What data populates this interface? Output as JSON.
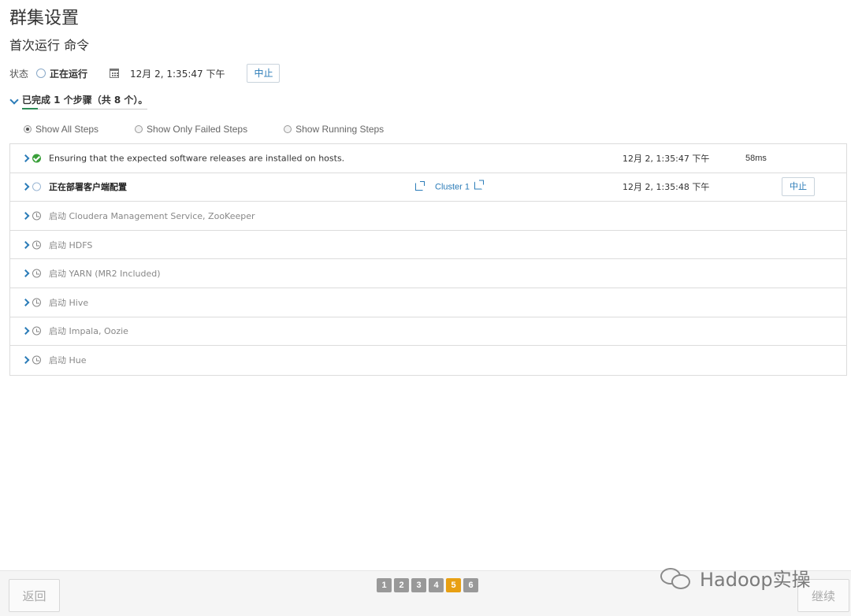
{
  "page": {
    "title": "群集设置",
    "subtitle": "首次运行 命令"
  },
  "status": {
    "label": "状态",
    "value": "正在运行",
    "timestamp": "12月 2, 1:35:47 下午",
    "abort_label": "中止"
  },
  "progress": {
    "summary": "已完成 1 个步骤（共 8 个）。",
    "completed": 1,
    "total": 8
  },
  "filters": [
    {
      "label": "Show All Steps",
      "checked": true
    },
    {
      "label": "Show Only Failed Steps",
      "checked": false
    },
    {
      "label": "Show Running Steps",
      "checked": false
    }
  ],
  "steps": [
    {
      "name": "Ensuring that the expected software releases are installed on hosts.",
      "state": "done",
      "time": "12月 2, 1:35:47 下午",
      "duration": "58ms"
    },
    {
      "name": "正在部署客户端配置",
      "state": "running",
      "time": "12月 2, 1:35:48 下午",
      "link": "Cluster 1",
      "abort_label": "中止"
    },
    {
      "name": "启动 Cloudera Management Service, ZooKeeper",
      "state": "pending"
    },
    {
      "name": "启动 HDFS",
      "state": "pending"
    },
    {
      "name": "启动 YARN (MR2 Included)",
      "state": "pending"
    },
    {
      "name": "启动 Hive",
      "state": "pending"
    },
    {
      "name": "启动 Impala, Oozie",
      "state": "pending"
    },
    {
      "name": "启动 Hue",
      "state": "pending"
    }
  ],
  "footer": {
    "back_label": "返回",
    "continue_label": "继续",
    "pages": [
      "1",
      "2",
      "3",
      "4",
      "5",
      "6"
    ],
    "active_page": "5"
  },
  "watermark": {
    "text": "Hadoop实操"
  },
  "colors": {
    "accent": "#2b7cb8",
    "success": "#3aa03a",
    "active_page": "#e8a013"
  }
}
